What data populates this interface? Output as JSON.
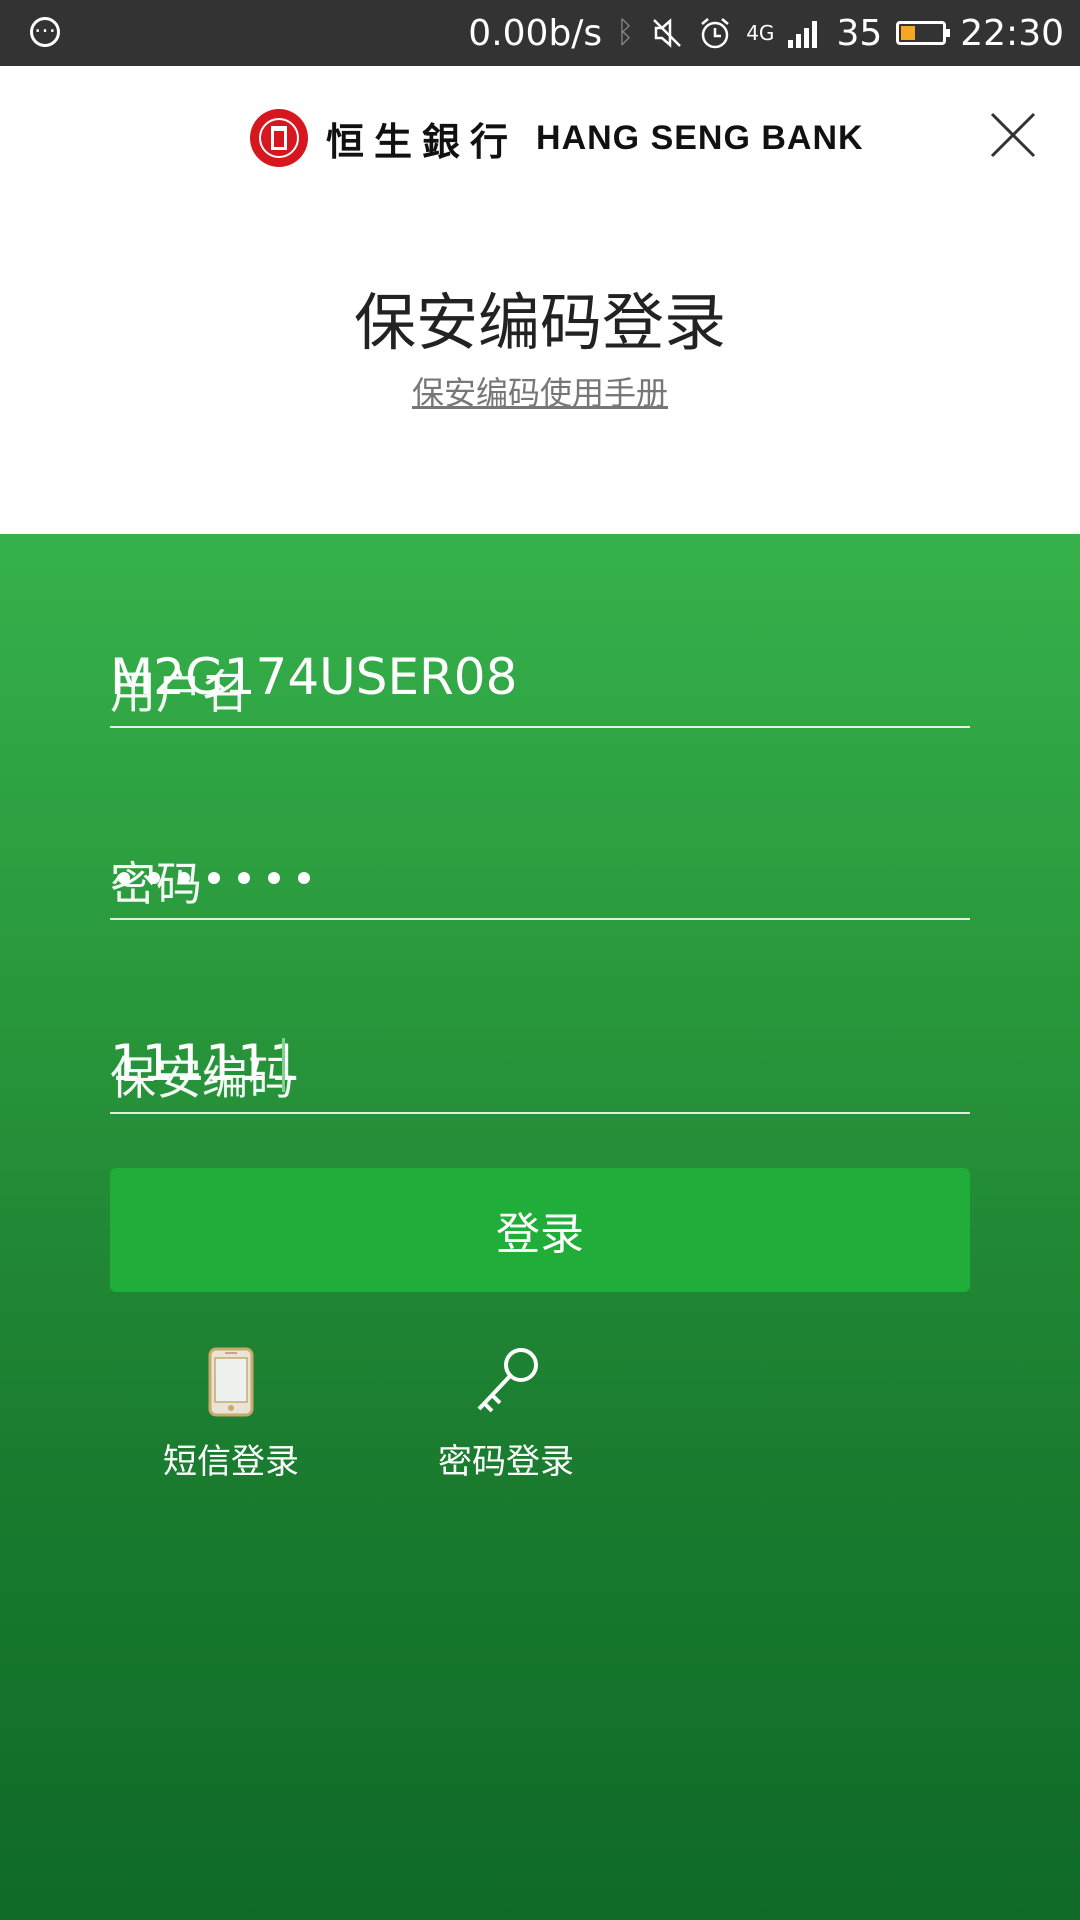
{
  "status_bar": {
    "speed": "0.00b/s",
    "network": "4G",
    "battery": "35",
    "time": "22:30",
    "battery_level": 0.35,
    "battery_color": "#f5a623"
  },
  "header": {
    "logo_cn": "恒生銀行",
    "logo_en": "HANG SENG BANK",
    "title": "保安编码登录",
    "manual_link": "保安编码使用手册"
  },
  "form": {
    "username_value": "M2G174USER08",
    "username_label": "用户名",
    "password_label": "密码",
    "password_dots": 7,
    "security_code_value": "111111",
    "security_code_label": "保安编码",
    "login_button": "登录"
  },
  "alt_logins": [
    {
      "label": "短信登录",
      "icon": "phone-icon"
    },
    {
      "label": "密码登录",
      "icon": "key-icon"
    }
  ],
  "colors": {
    "brand_red": "#d7171f",
    "green_top": "#36b14b",
    "green_bottom": "#0f6a28",
    "button_green": "#21ad39"
  }
}
